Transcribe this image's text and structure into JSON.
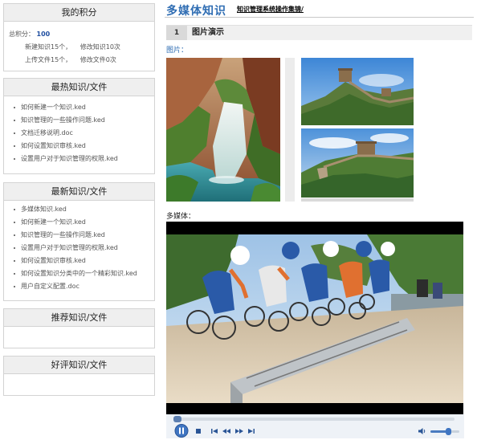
{
  "sidebar": {
    "score_panel": {
      "title": "我的积分",
      "total_label": "总积分：",
      "total_value": "100",
      "row1_a": "新建知识15个，",
      "row1_b": "修改知识10次",
      "row2_a": "上传文件15个，",
      "row2_b": "修改文件0次"
    },
    "hot_panel": {
      "title": "最热知识/文件",
      "items": [
        {
          "label": "如何新建一个知识.ked"
        },
        {
          "label": "知识管理的一些操作问题.ked"
        },
        {
          "label": "文档迁移说明.doc"
        },
        {
          "label": "如何设置知识审核.ked"
        },
        {
          "label": "设置用户对于知识管理的权限.ked"
        }
      ]
    },
    "new_panel": {
      "title": "最新知识/文件",
      "items": [
        {
          "label": "多媒体知识.ked"
        },
        {
          "label": "如何新建一个知识.ked"
        },
        {
          "label": "知识管理的一些操作问题.ked"
        },
        {
          "label": "设置用户对于知识管理的权限.ked"
        },
        {
          "label": "如何设置知识审核.ked"
        },
        {
          "label": "如何设置知识分类中的一个精彩知识.ked"
        },
        {
          "label": "用户自定义配置.doc"
        }
      ]
    },
    "recommend_panel": {
      "title": "推荐知识/文件"
    },
    "praise_panel": {
      "title": "好评知识/文件"
    }
  },
  "main": {
    "title": "多媒体知识",
    "link": "知识管理系统操作集锦/",
    "section_number": "1",
    "section_title": "图片演示",
    "pictures_label": "图片：",
    "multimedia_label": "多媒体："
  },
  "colors": {
    "accent_blue": "#2f6db3",
    "panel_header_bg": "#efefef",
    "score_value": "#1f4ea0"
  },
  "icons": [
    "play-pause-icon",
    "stop-icon",
    "previous-icon",
    "rewind-icon",
    "fast-forward-icon",
    "next-icon",
    "volume-icon"
  ]
}
